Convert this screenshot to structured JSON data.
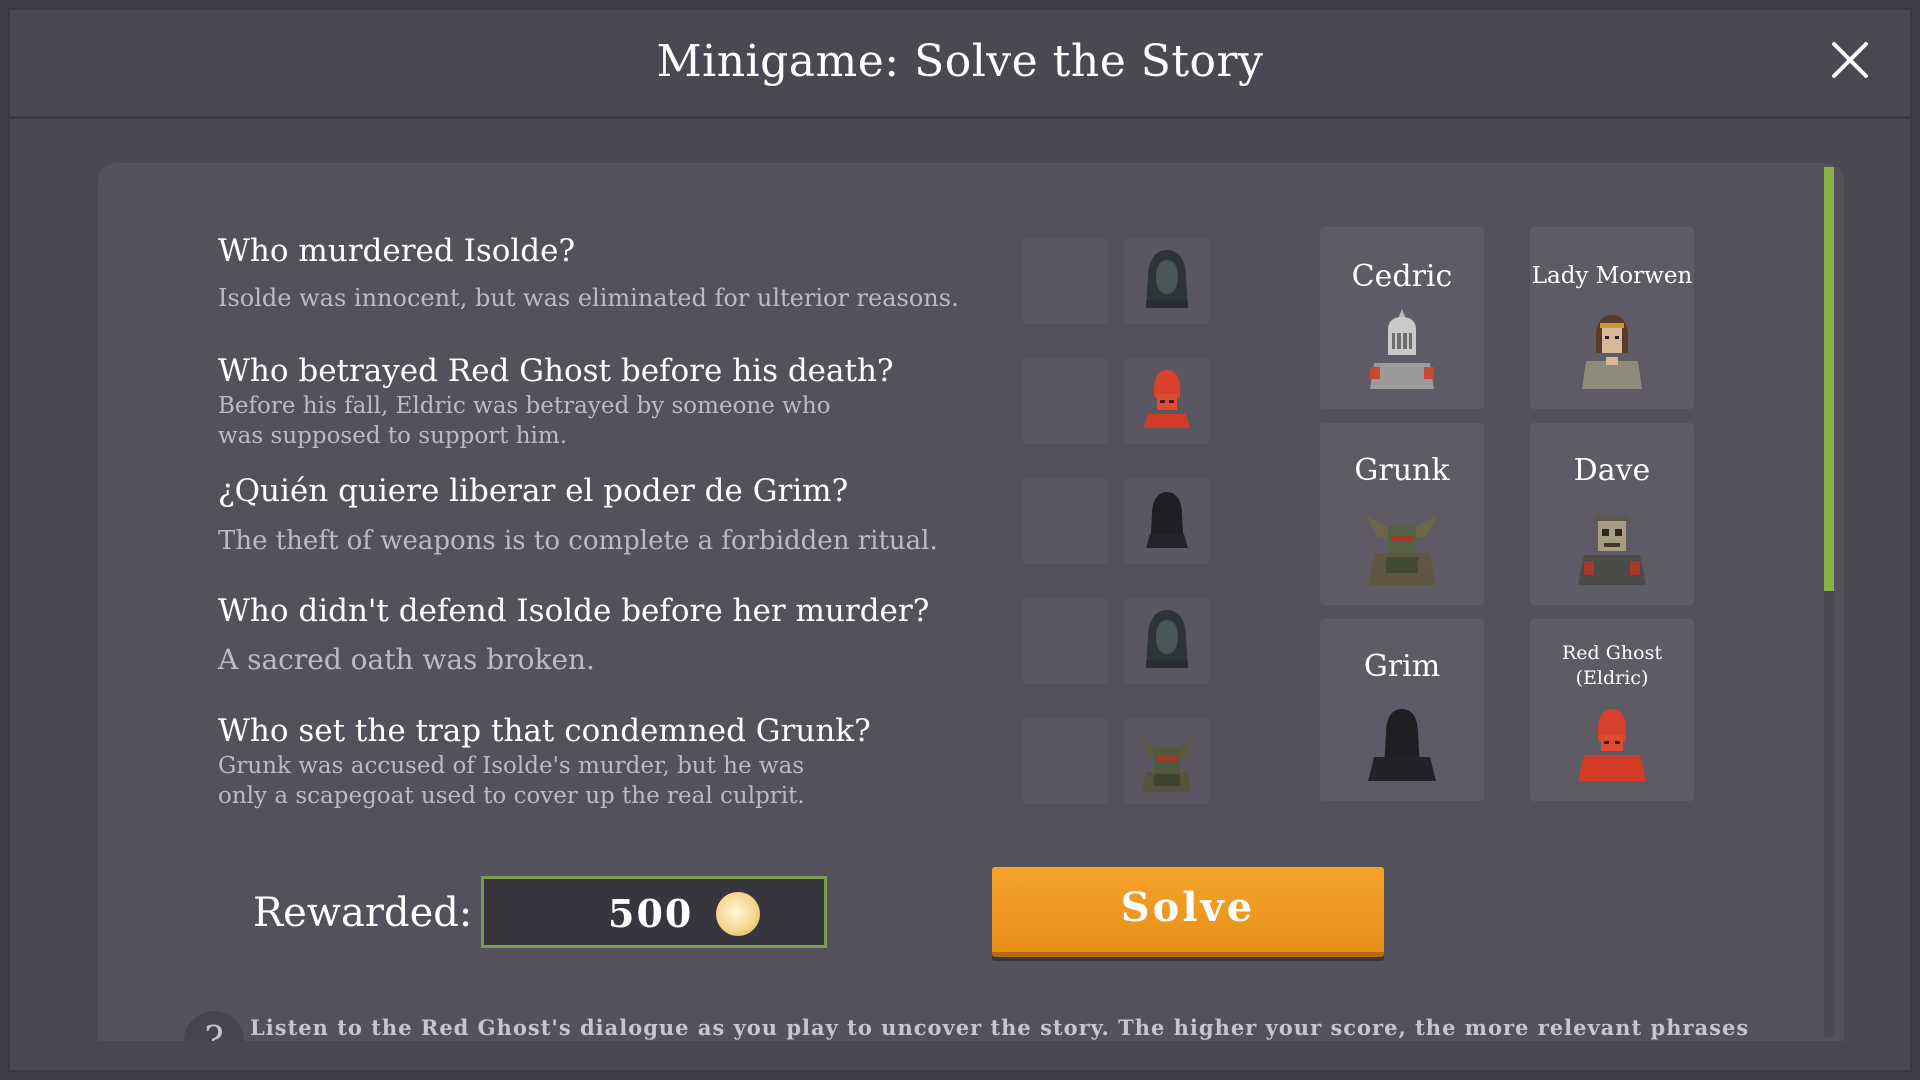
{
  "window": {
    "title": "Minigame: Solve the Story",
    "close_icon": "close-icon"
  },
  "questions": [
    {
      "title": "Who murdered Isolde?",
      "description": "Isolde was innocent, but was eliminated for ulterior reasons.",
      "assigned_icon": "hooded-figure-icon"
    },
    {
      "title": "Who betrayed Red Ghost before his death?",
      "description": "Before his fall, Eldric was betrayed by someone who was supposed to support him.",
      "assigned_icon": "red-ghost-icon"
    },
    {
      "title": "¿Quién quiere liberar el poder de Grim?",
      "description": "The theft of weapons is to complete a forbidden ritual.",
      "assigned_icon": "grim-icon"
    },
    {
      "title": "Who didn't defend Isolde before her murder?",
      "description": "A sacred oath was broken.",
      "assigned_icon": "hooded-figure-icon"
    },
    {
      "title": "Who set the trap that condemned Grunk?",
      "description": "Grunk was accused of Isolde's murder, but he was only a scapegoat used to cover up the real culprit.",
      "assigned_icon": "grunk-icon"
    }
  ],
  "characters": [
    {
      "name": "Cedric",
      "icon": "knight-icon"
    },
    {
      "name": "Lady Morwen",
      "icon": "lady-icon"
    },
    {
      "name": "Grunk",
      "icon": "goblin-icon"
    },
    {
      "name": "Dave",
      "icon": "skeleton-icon"
    },
    {
      "name": "Grim",
      "icon": "hooded-shadow-icon"
    },
    {
      "name": "Red Ghost (Eldric)",
      "icon": "red-ghost-icon"
    }
  ],
  "reward": {
    "label": "Rewarded:",
    "value": "500",
    "icon": "coin-icon"
  },
  "solve_button": {
    "label": "Solve"
  },
  "hint": {
    "text": "Listen to the Red Ghost's dialogue as you play to uncover the story. The higher your score, the more relevant phrases"
  },
  "colors": {
    "accent_orange": "#f0991f",
    "scroll_green": "#86b347",
    "panel": "#54515c"
  }
}
